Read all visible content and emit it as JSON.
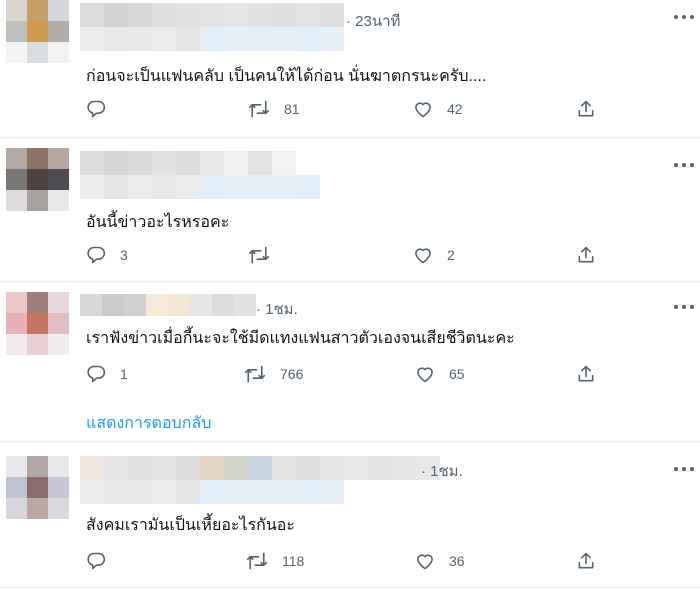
{
  "tweets": [
    {
      "time": "· 23นาที",
      "text": "ก่อนจะเป็นแฟนคลับ เป็นคนให้ได้ก่อน นั่นฆาตกรนะครับ....",
      "replies": "",
      "retweets": "81",
      "likes": "42"
    },
    {
      "time": "",
      "text": "อันนี้ข่าวอะไรหรอคะ",
      "replies": "3",
      "retweets": "",
      "likes": "2"
    },
    {
      "time": "· 1ชม.",
      "text": "เราฟังข่าวเมื่อกี้นะจะใช้มีดแทงแฟนสาวตัวเองจนเสียชีวิตนะคะ",
      "replies": "1",
      "retweets": "766",
      "likes": "65"
    },
    {
      "time": "· 1ชม.",
      "text": "สังคมเรามันเป็นเหี้ยอะไรกันอะ",
      "replies": "",
      "retweets": "118",
      "likes": "36"
    }
  ],
  "show_replies_label": "แสดงการตอบกลับ",
  "colors": {
    "accent": "#1d9bf0",
    "icon": "#536471",
    "divider": "#e6ecf0"
  },
  "avatars": [
    [
      "#d9d4cc",
      "#c4a066",
      "#d4d6da",
      "#bfbfbd",
      "#cf9a4d",
      "#b3ada9",
      "#f4f4f4",
      "#d8dde3",
      "#f2f2f2"
    ],
    [
      "#b3aaa6",
      "#8b7464",
      "#b5a8a0",
      "#7a7676",
      "#4e4140",
      "#4e4c50",
      "#dedcdc",
      "#a6a2a0",
      "#e9e8e8"
    ],
    [
      "#eec6c8",
      "#9f7e7c",
      "#e8d7dc",
      "#e8b1b5",
      "#c47660",
      "#e1bcc0",
      "#f0eaec",
      "#e8d0d3",
      "#f2eeef"
    ],
    [
      "#e9e9ec",
      "#b2a6a8",
      "#e8e8ea",
      "#bfc2d0",
      "#8d6b6c",
      "#c7c5d3",
      "#d8d6dc",
      "#bba7a5",
      "#d8d8de"
    ]
  ],
  "name_blurs": [
    [
      [
        "#dcdcdc",
        "#d2d2d2",
        "#d8d8d8",
        "#e0e0e0",
        "#e2e2e2",
        "#e4e4e4",
        "#e6e6e6",
        "#e2e2e2",
        "#e0e0e0",
        "#e4e4e4",
        "#dedede"
      ],
      [
        "#eeeeee",
        "#e8e8e8",
        "#eaeaea",
        "#ececec",
        "#e6e6e6",
        "#e2eef8",
        "#e6f0f8",
        "#e4eff8",
        "#e6f0f8",
        "#e2eef8",
        "#e8f1f9"
      ]
    ],
    [
      [
        "#dcdcdc",
        "#d4d4d4",
        "#dadada",
        "#e2e2e2",
        "#dcdcdc",
        "#e8e8e8",
        "#f0f0f0",
        "#e4e4e4",
        "#f2f2f2",
        "#ffffff",
        "#ffffff"
      ],
      [
        "#eeeeee",
        "#e6e6e6",
        "#ececec",
        "#e8e8e8",
        "#ebebeb",
        "#e2eef8",
        "#e6f0f8",
        "#e4eff8",
        "#e6f0f8",
        "#e2eef8",
        "#ffffff"
      ]
    ],
    [
      [
        "#d8d8d8",
        "#cacaca",
        "#d0d0d0",
        "#f4ecd8",
        "#f2e8d4",
        "#e6e6e6",
        "#dcdcdc",
        "#e2e2e2",
        "#ffffff",
        "#ffffff",
        "#ffffff"
      ],
      [
        "#ffffff",
        "#ffffff",
        "#ffffff",
        "#ffffff",
        "#ffffff",
        "#ffffff",
        "#ffffff",
        "#ffffff",
        "#ffffff",
        "#ffffff",
        "#ffffff"
      ]
    ],
    [
      [
        "#f2e6e0",
        "#e6e6e6",
        "#e2e2e2",
        "#e4e4e4",
        "#dcdcdc",
        "#e2d6c0",
        "#d2d4cc",
        "#c8d4e0",
        "#e4e4e4",
        "#e0e0e0",
        "#e6e6e6",
        "#e8e8e8",
        "#e4e4e4",
        "#e6e6e6",
        "#e8e8e8"
      ],
      [
        "#eeeeee",
        "#e8e8e8",
        "#eaeaea",
        "#ececec",
        "#e6e6e6",
        "#e2eef8",
        "#e6f0f8",
        "#e4eff8",
        "#e6f0f8",
        "#e2eef8",
        "#e8f1f9",
        "#ffffff",
        "#ffffff",
        "#ffffff",
        "#ffffff"
      ]
    ]
  ]
}
